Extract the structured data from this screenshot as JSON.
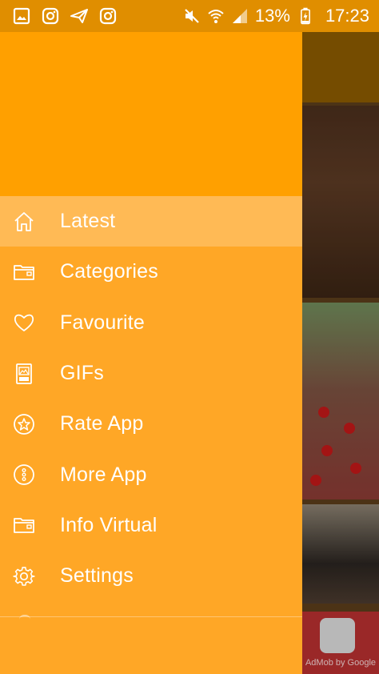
{
  "status_bar": {
    "battery_percent": "13%",
    "time": "17:23",
    "icons": [
      "gallery-icon",
      "instagram-icon",
      "send-icon",
      "instagram-icon",
      "mute-icon",
      "wifi-icon",
      "signal-icon",
      "battery-charging-icon"
    ]
  },
  "colors": {
    "status_bar": "#e08e00",
    "drawer_header": "#ffa000",
    "drawer_body": "#ffa726"
  },
  "drawer": {
    "menu": [
      {
        "label": "Latest",
        "icon": "home-icon",
        "active": true
      },
      {
        "label": "Categories",
        "icon": "folder-icon",
        "active": false
      },
      {
        "label": "Favourite",
        "icon": "heart-icon",
        "active": false
      },
      {
        "label": "GIFs",
        "icon": "gif-file-icon",
        "active": false
      },
      {
        "label": "Rate App",
        "icon": "star-badge-icon",
        "active": false
      },
      {
        "label": "More App",
        "icon": "more-vertical-circle-icon",
        "active": false
      },
      {
        "label": "Info Virtual",
        "icon": "folder-icon",
        "active": false
      },
      {
        "label": "Settings",
        "icon": "gear-icon",
        "active": false
      }
    ]
  },
  "ad": {
    "label": "AdMob by Google"
  }
}
